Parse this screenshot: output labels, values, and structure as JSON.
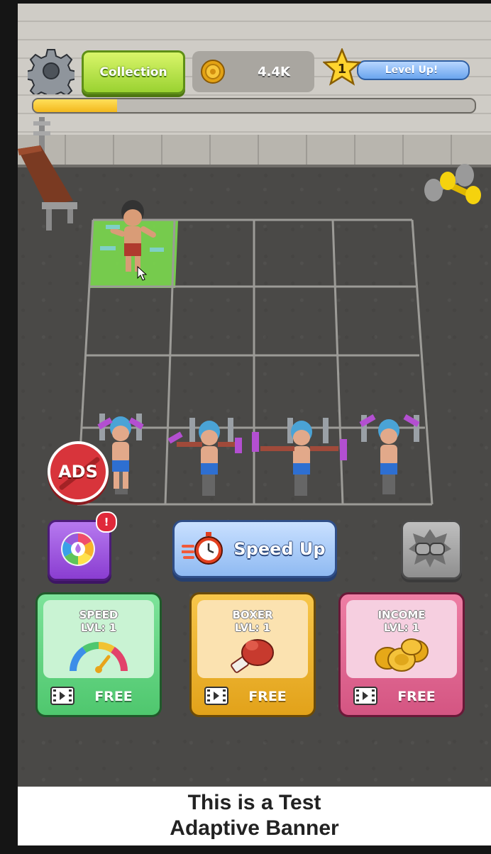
{
  "hud": {
    "collection_label": "Collection",
    "coins_value": "4.4K",
    "level_number": "1",
    "level_label": "Level Up!",
    "progress_fraction": 0.19
  },
  "actions": {
    "ads_label": "ADS",
    "alert_badge": "!",
    "speed_up_label": "Speed Up"
  },
  "upgrades": [
    {
      "title": "SPEED",
      "level": "LVL: 1",
      "price": "FREE",
      "icon": "speedometer-icon"
    },
    {
      "title": "BOXER",
      "level": "LVL: 1",
      "price": "FREE",
      "icon": "boxing-glove-icon"
    },
    {
      "title": "INCOME",
      "level": "LVL: 1",
      "price": "FREE",
      "icon": "coins-stack-icon"
    }
  ],
  "banner": {
    "line1": "This is a Test",
    "line2": "Adaptive Banner"
  },
  "colors": {
    "collection_green": "#9ad231",
    "speed_blue": "#8fbaf2",
    "wheel_purple": "#8a3dd1",
    "speed_card": "#6fdc8a",
    "boxer_card": "#f0b42a",
    "income_card": "#e06a93",
    "active_cell": "#7bd94e"
  }
}
